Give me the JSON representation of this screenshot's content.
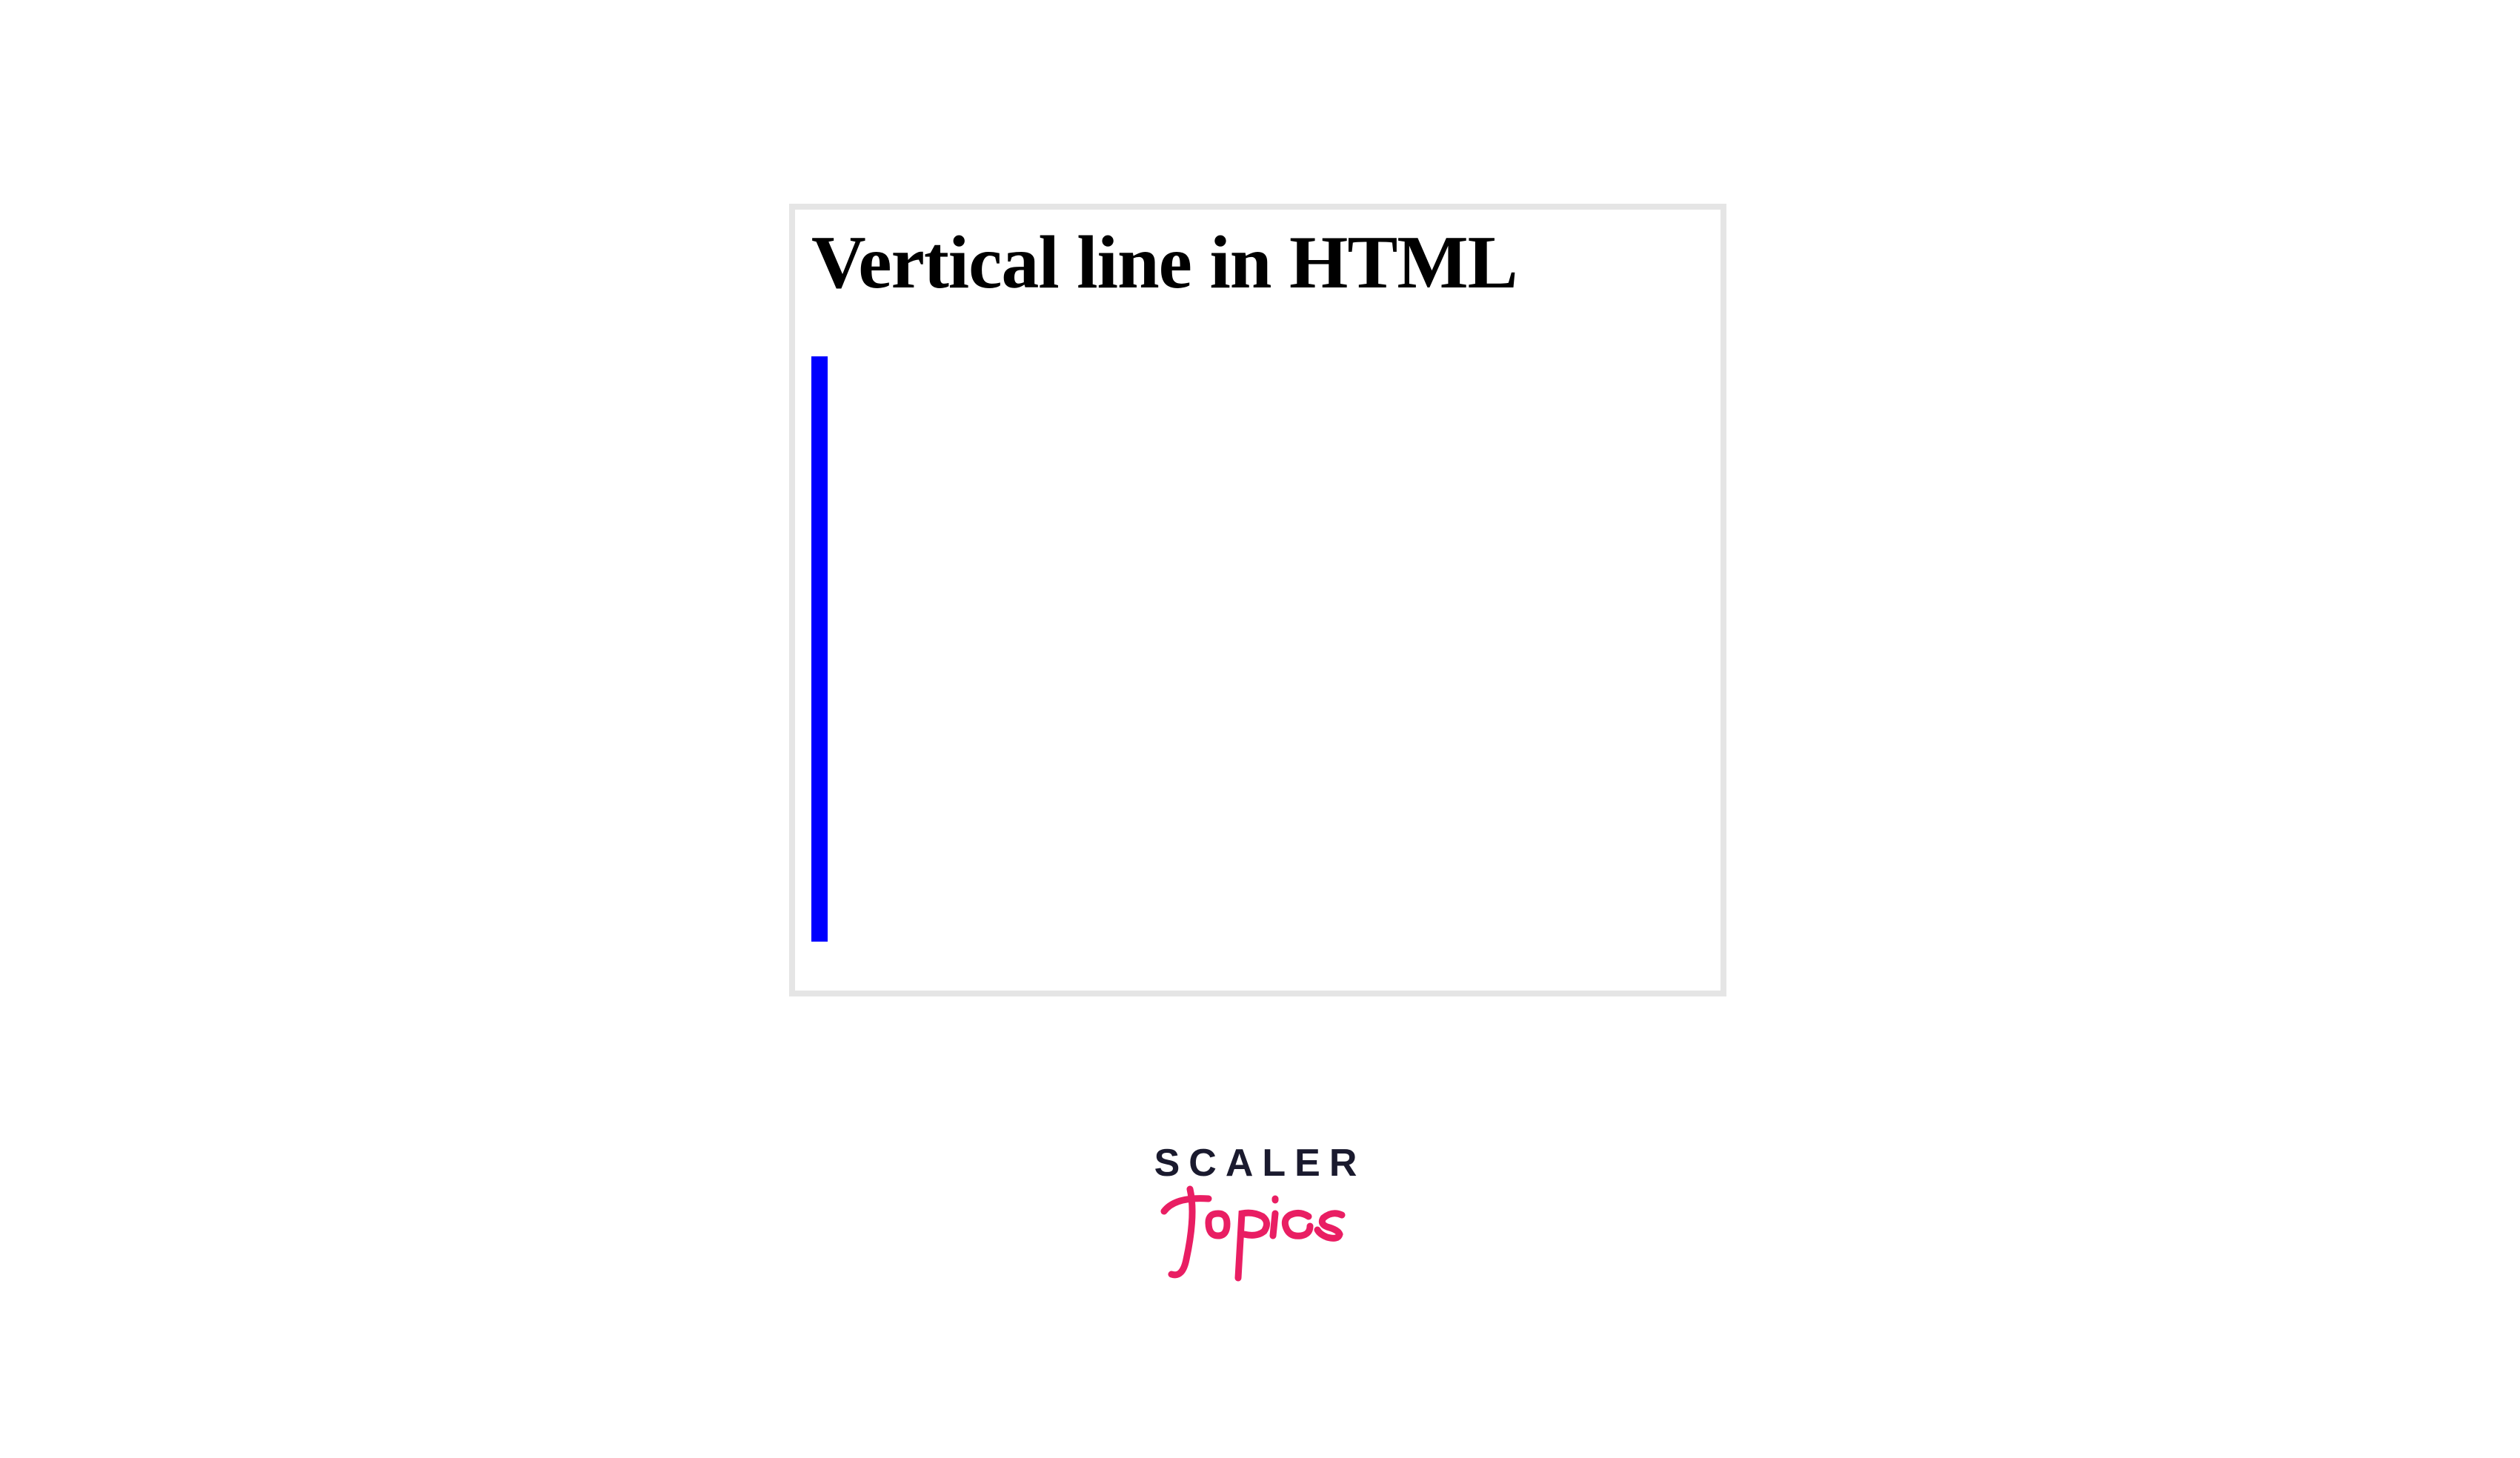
{
  "heading": "Vertical line in HTML",
  "logo": {
    "scaler": "SCALER",
    "topics": "Topics"
  },
  "colors": {
    "line": "#0000ff",
    "border": "#e5e5e5",
    "logo_dark": "#1a1a2e",
    "logo_pink": "#e91e63"
  }
}
